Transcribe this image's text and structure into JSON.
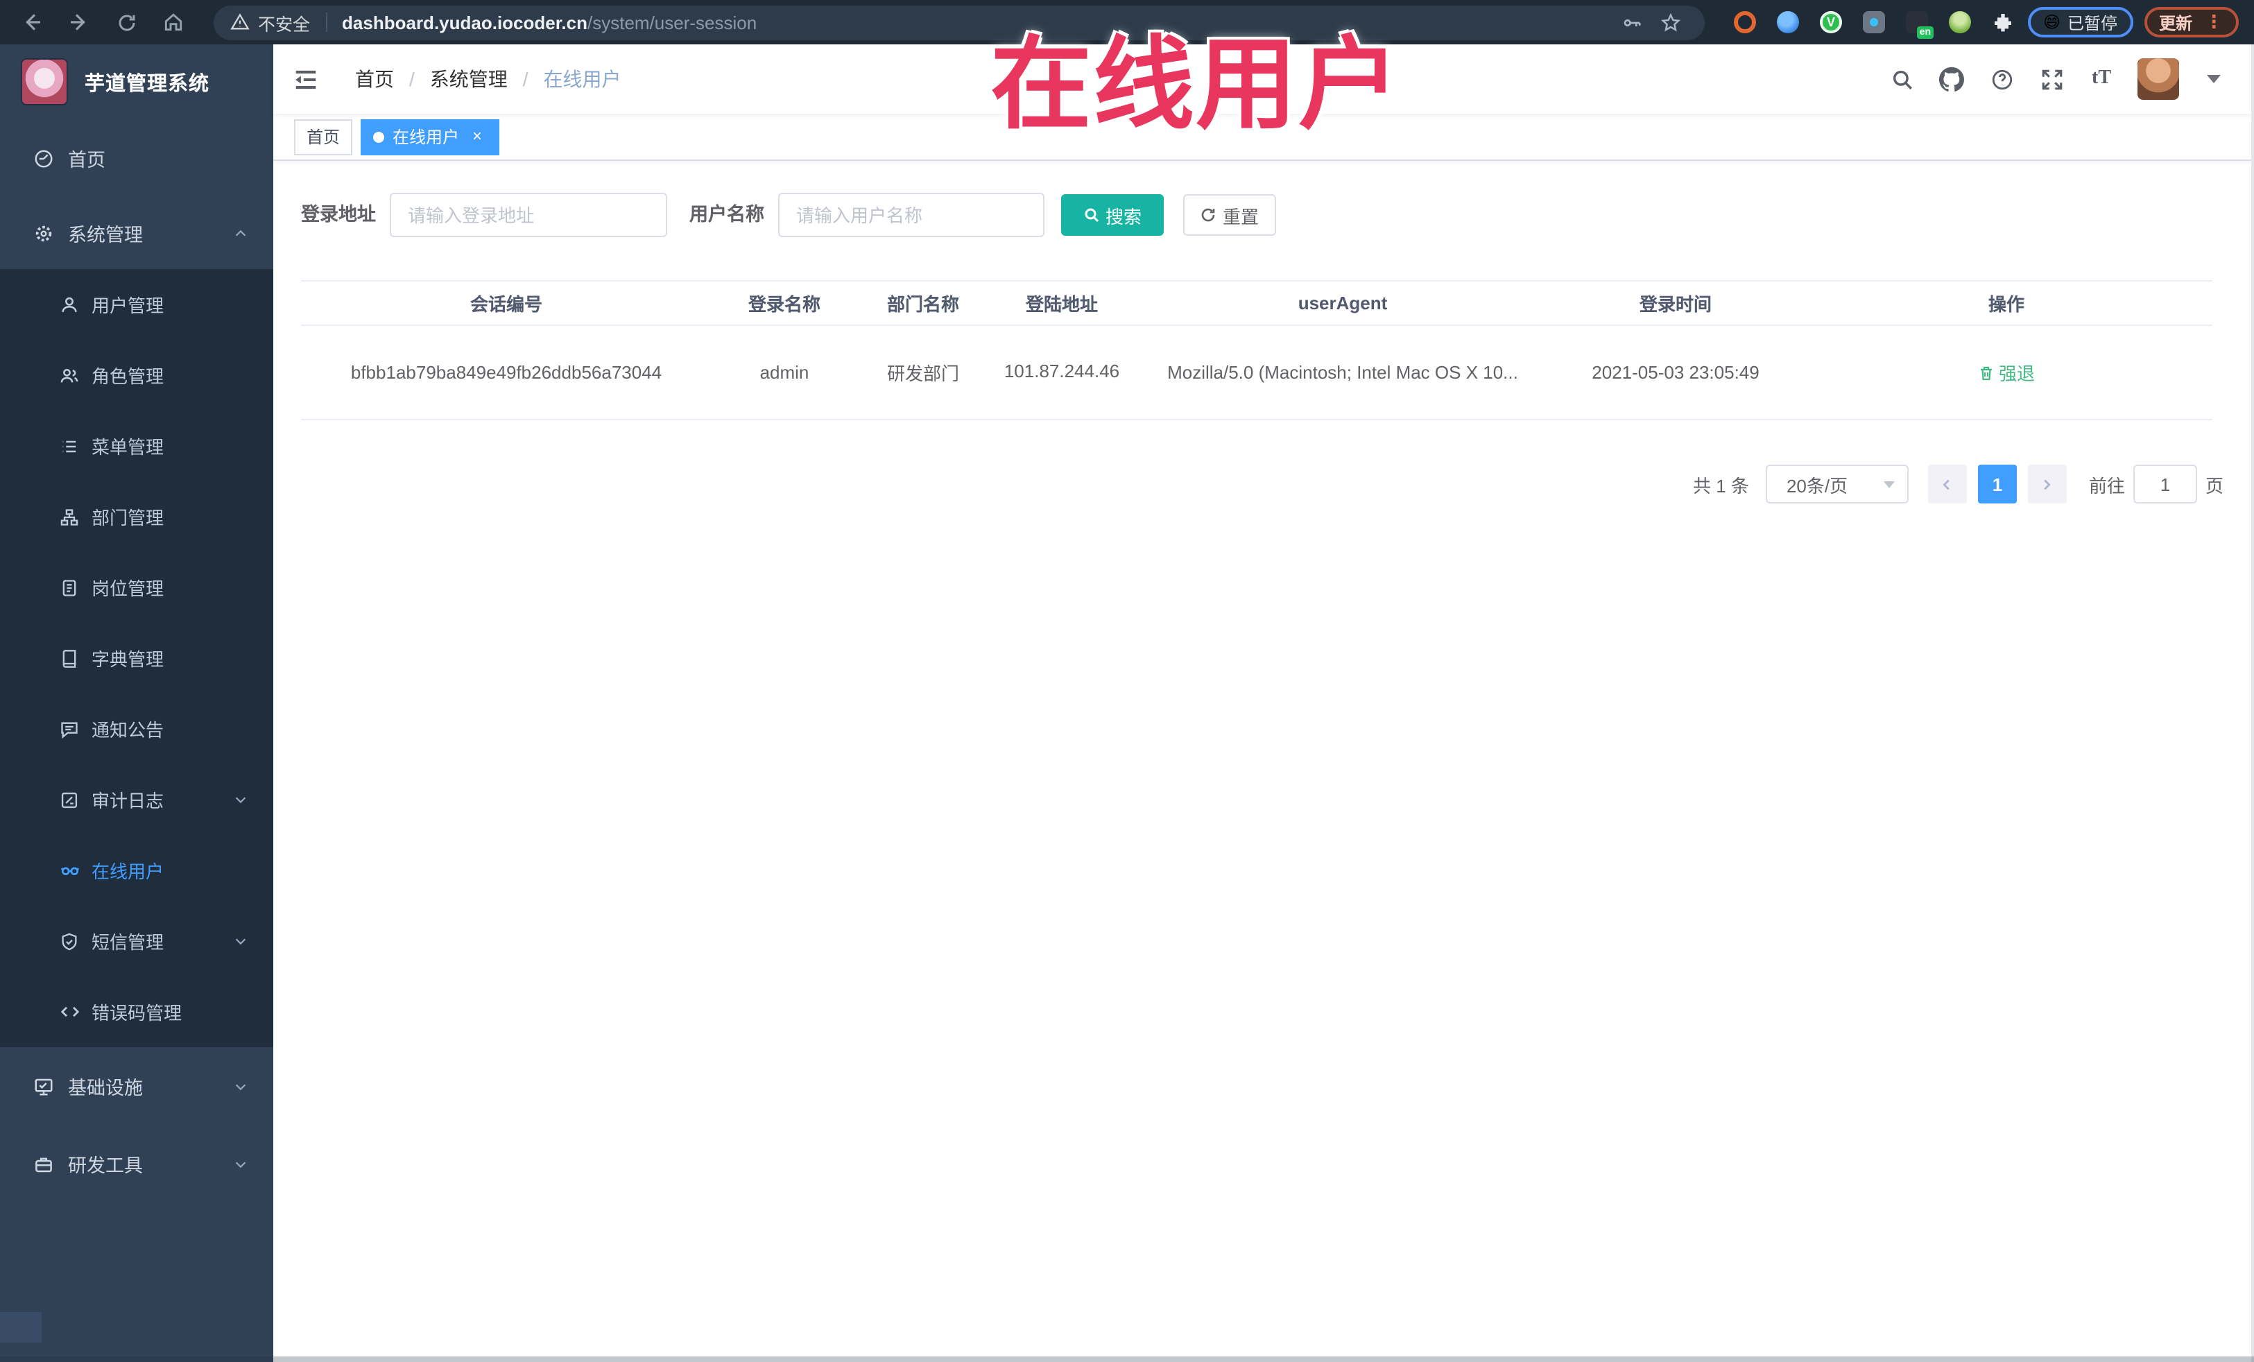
{
  "browser": {
    "security_label": "不安全",
    "url_domain": "dashboard.yudao.iocoder.cn",
    "url_path": "/system/user-session",
    "paused_chip": {
      "emoji": "😄",
      "label": "已暂停"
    },
    "update_label": "更新"
  },
  "watermark_text": "在线用户",
  "sidebar": {
    "app_title": "芋道管理系统",
    "items": [
      {
        "label": "首页",
        "level": "top",
        "icon": "dashboard-icon"
      },
      {
        "label": "系统管理",
        "level": "top",
        "icon": "gear-icon",
        "arrow": "up"
      },
      {
        "label": "用户管理",
        "level": "sub",
        "icon": "user-icon"
      },
      {
        "label": "角色管理",
        "level": "sub",
        "icon": "roles-icon"
      },
      {
        "label": "菜单管理",
        "level": "sub",
        "icon": "menu-list-icon"
      },
      {
        "label": "部门管理",
        "level": "sub",
        "icon": "org-tree-icon"
      },
      {
        "label": "岗位管理",
        "level": "sub",
        "icon": "post-badge-icon"
      },
      {
        "label": "字典管理",
        "level": "sub",
        "icon": "dictionary-icon"
      },
      {
        "label": "通知公告",
        "level": "sub",
        "icon": "announcement-icon"
      },
      {
        "label": "审计日志",
        "level": "sub",
        "icon": "audit-log-icon",
        "arrow": "down"
      },
      {
        "label": "在线用户",
        "level": "sub",
        "icon": "online-users-icon",
        "active": true
      },
      {
        "label": "短信管理",
        "level": "sub",
        "icon": "sms-shield-icon",
        "arrow": "down"
      },
      {
        "label": "错误码管理",
        "level": "sub",
        "icon": "error-code-icon"
      },
      {
        "label": "基础设施",
        "level": "top",
        "icon": "infrastructure-icon",
        "arrow": "down"
      },
      {
        "label": "研发工具",
        "level": "top",
        "icon": "dev-tools-icon",
        "arrow": "down"
      }
    ]
  },
  "header": {
    "breadcrumb": [
      "首页",
      "系统管理",
      "在线用户"
    ],
    "separator": "/"
  },
  "tabs": [
    {
      "label": "首页",
      "active": false
    },
    {
      "label": "在线用户",
      "active": true
    }
  ],
  "filters": {
    "login_address_label": "登录地址",
    "login_address_placeholder": "请输入登录地址",
    "username_label": "用户名称",
    "username_placeholder": "请输入用户名称",
    "search_label": "搜索",
    "reset_label": "重置"
  },
  "table": {
    "columns": [
      "会话编号",
      "登录名称",
      "部门名称",
      "登陆地址",
      "userAgent",
      "登录时间",
      "操作"
    ],
    "rows": [
      {
        "session_id": "bfbb1ab79ba849e49fb26ddb56a73044",
        "username": "admin",
        "dept_name": "研发部门",
        "login_ip": "101.87.244.46",
        "user_agent": "Mozilla/5.0 (Macintosh; Intel Mac OS X 10...",
        "login_time": "2021-05-03 23:05:49",
        "action_label": "强退"
      }
    ]
  },
  "pagination": {
    "total_label": "共 1 条",
    "page_size": "20条/页",
    "current_page": "1",
    "goto_label": "前往",
    "goto_value": "1",
    "page_unit_label": "页"
  },
  "colors": {
    "accent_blue": "#409EFF",
    "search_button_teal": "#17B3A3",
    "action_green": "#42B983",
    "watermark_red": "#E8365E",
    "sidebar_bg": "#304156",
    "submenu_bg": "#1F2D3D"
  }
}
